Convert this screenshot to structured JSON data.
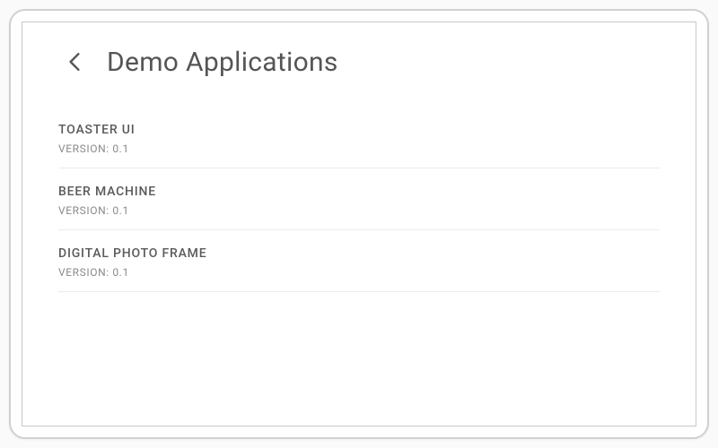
{
  "header": {
    "title": "Demo Applications"
  },
  "apps": [
    {
      "title": "TOASTER UI",
      "subtitle": "VERSION: 0.1"
    },
    {
      "title": "BEER MACHINE",
      "subtitle": "VERSION: 0.1"
    },
    {
      "title": "DIGITAL PHOTO FRAME",
      "subtitle": "VERSION: 0.1"
    }
  ]
}
